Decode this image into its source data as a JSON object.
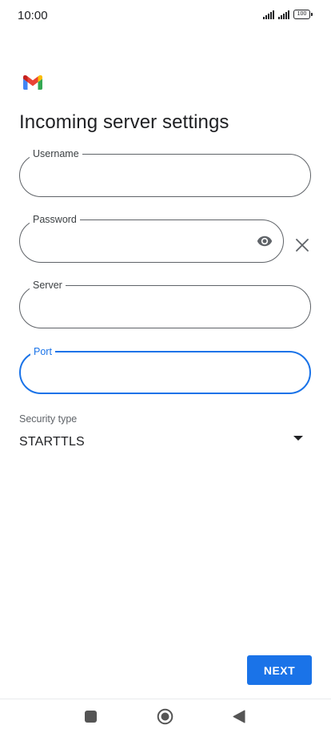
{
  "status_bar": {
    "time": "10:00",
    "battery": "100"
  },
  "header": {
    "logo": "gmail-logo",
    "title": "Incoming server settings"
  },
  "form": {
    "username": {
      "label": "Username",
      "value": ""
    },
    "password": {
      "label": "Password",
      "value": ""
    },
    "server": {
      "label": "Server",
      "value": ""
    },
    "port": {
      "label": "Port",
      "value": ""
    }
  },
  "security": {
    "label": "Security type",
    "selected": "STARTTLS"
  },
  "actions": {
    "next_label": "NEXT"
  },
  "icons": {
    "password_toggle": "eye-icon",
    "clear": "close-icon",
    "dropdown": "caret-down-icon",
    "nav_recent": "square-icon",
    "nav_home": "circle-icon",
    "nav_back": "triangle-back-icon"
  },
  "colors": {
    "accent": "#1a73e8",
    "outline": "#5f6368",
    "text": "#202124"
  }
}
